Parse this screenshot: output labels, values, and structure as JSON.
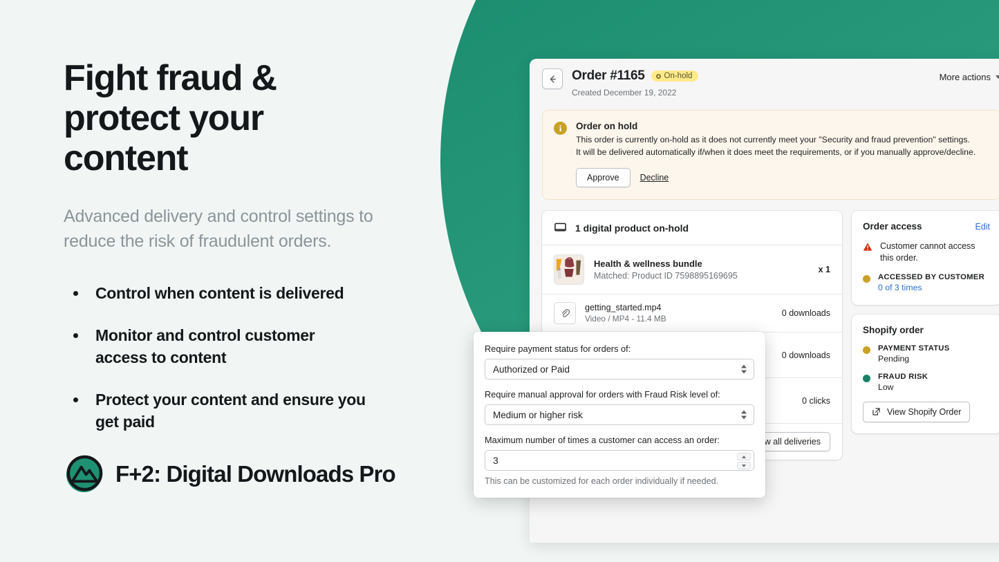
{
  "marketing": {
    "headline": "Fight fraud & protect your content",
    "subhead": "Advanced delivery and control settings to reduce the risk of fraudulent orders.",
    "bullets": [
      "Control when content is delivered",
      "Monitor and control customer access to content",
      "Protect your content and ensure you get paid"
    ],
    "brand_name": "F+2: Digital Downloads Pro",
    "logo_icon": "mountain-circle-logo"
  },
  "colors": {
    "background": "#f1f6f4",
    "brand_green": "#2a9b7c",
    "accent_amber": "#c8a227",
    "link_blue": "#2c6ecb",
    "badge_yellow": "#ffea8a",
    "banner_bg": "#fdf6ec"
  },
  "order": {
    "back_icon": "arrow-left-icon",
    "title": "Order #1165",
    "status_badge": "On-hold",
    "created": "Created December 19, 2022",
    "more_actions": "More actions",
    "more_actions_icon": "chevron-down-icon"
  },
  "banner": {
    "icon": "info-icon",
    "title": "Order on hold",
    "body": "This order is currently on-hold as it does not currently meet your \"Security and fraud prevention\" settings. It will be delivered automatically if/when it does meet the requirements, or if you manually approve/decline.",
    "approve_label": "Approve",
    "decline_label": "Decline"
  },
  "products_card": {
    "header_icon": "monitor-icon",
    "header_title": "1 digital product on-hold",
    "product": {
      "thumb_icon": "product-photo",
      "name": "Health & wellness bundle",
      "matched": "Matched: Product ID 7598895169695",
      "quantity": "x 1"
    },
    "files": [
      {
        "icon": "paperclip-icon",
        "name": "getting_started.mp4",
        "meta": "Video / MP4 - 11.4 MB",
        "stat": "0 downloads"
      },
      {
        "icon": "paperclip-icon",
        "name": "",
        "meta": "",
        "stat": "0 downloads"
      },
      {
        "icon": "link-icon",
        "name": "",
        "meta": "",
        "stat": "0 clicks"
      }
    ],
    "footer_button": "View all deliveries"
  },
  "order_access": {
    "title": "Order access",
    "edit_label": "Edit",
    "warning_icon": "warning-triangle-icon",
    "warning_text": "Customer cannot access this order.",
    "accessed_label": "ACCESSED BY CUSTOMER",
    "accessed_value": "0 of 3 times"
  },
  "shopify_order": {
    "title": "Shopify order",
    "payment_label": "PAYMENT STATUS",
    "payment_value": "Pending",
    "fraud_label": "FRAUD RISK",
    "fraud_value": "Low",
    "view_button": "View Shopify Order",
    "view_button_icon": "external-link-icon"
  },
  "settings_dialog": {
    "payment_status_label": "Require payment status for orders of:",
    "payment_status_value": "Authorized or Paid",
    "fraud_risk_label": "Require manual approval for orders with Fraud Risk level of:",
    "fraud_risk_value": "Medium or higher risk",
    "max_access_label": "Maximum number of times a customer can access an order:",
    "max_access_value": "3",
    "help_text": "This can be customized for each order individually if needed."
  }
}
